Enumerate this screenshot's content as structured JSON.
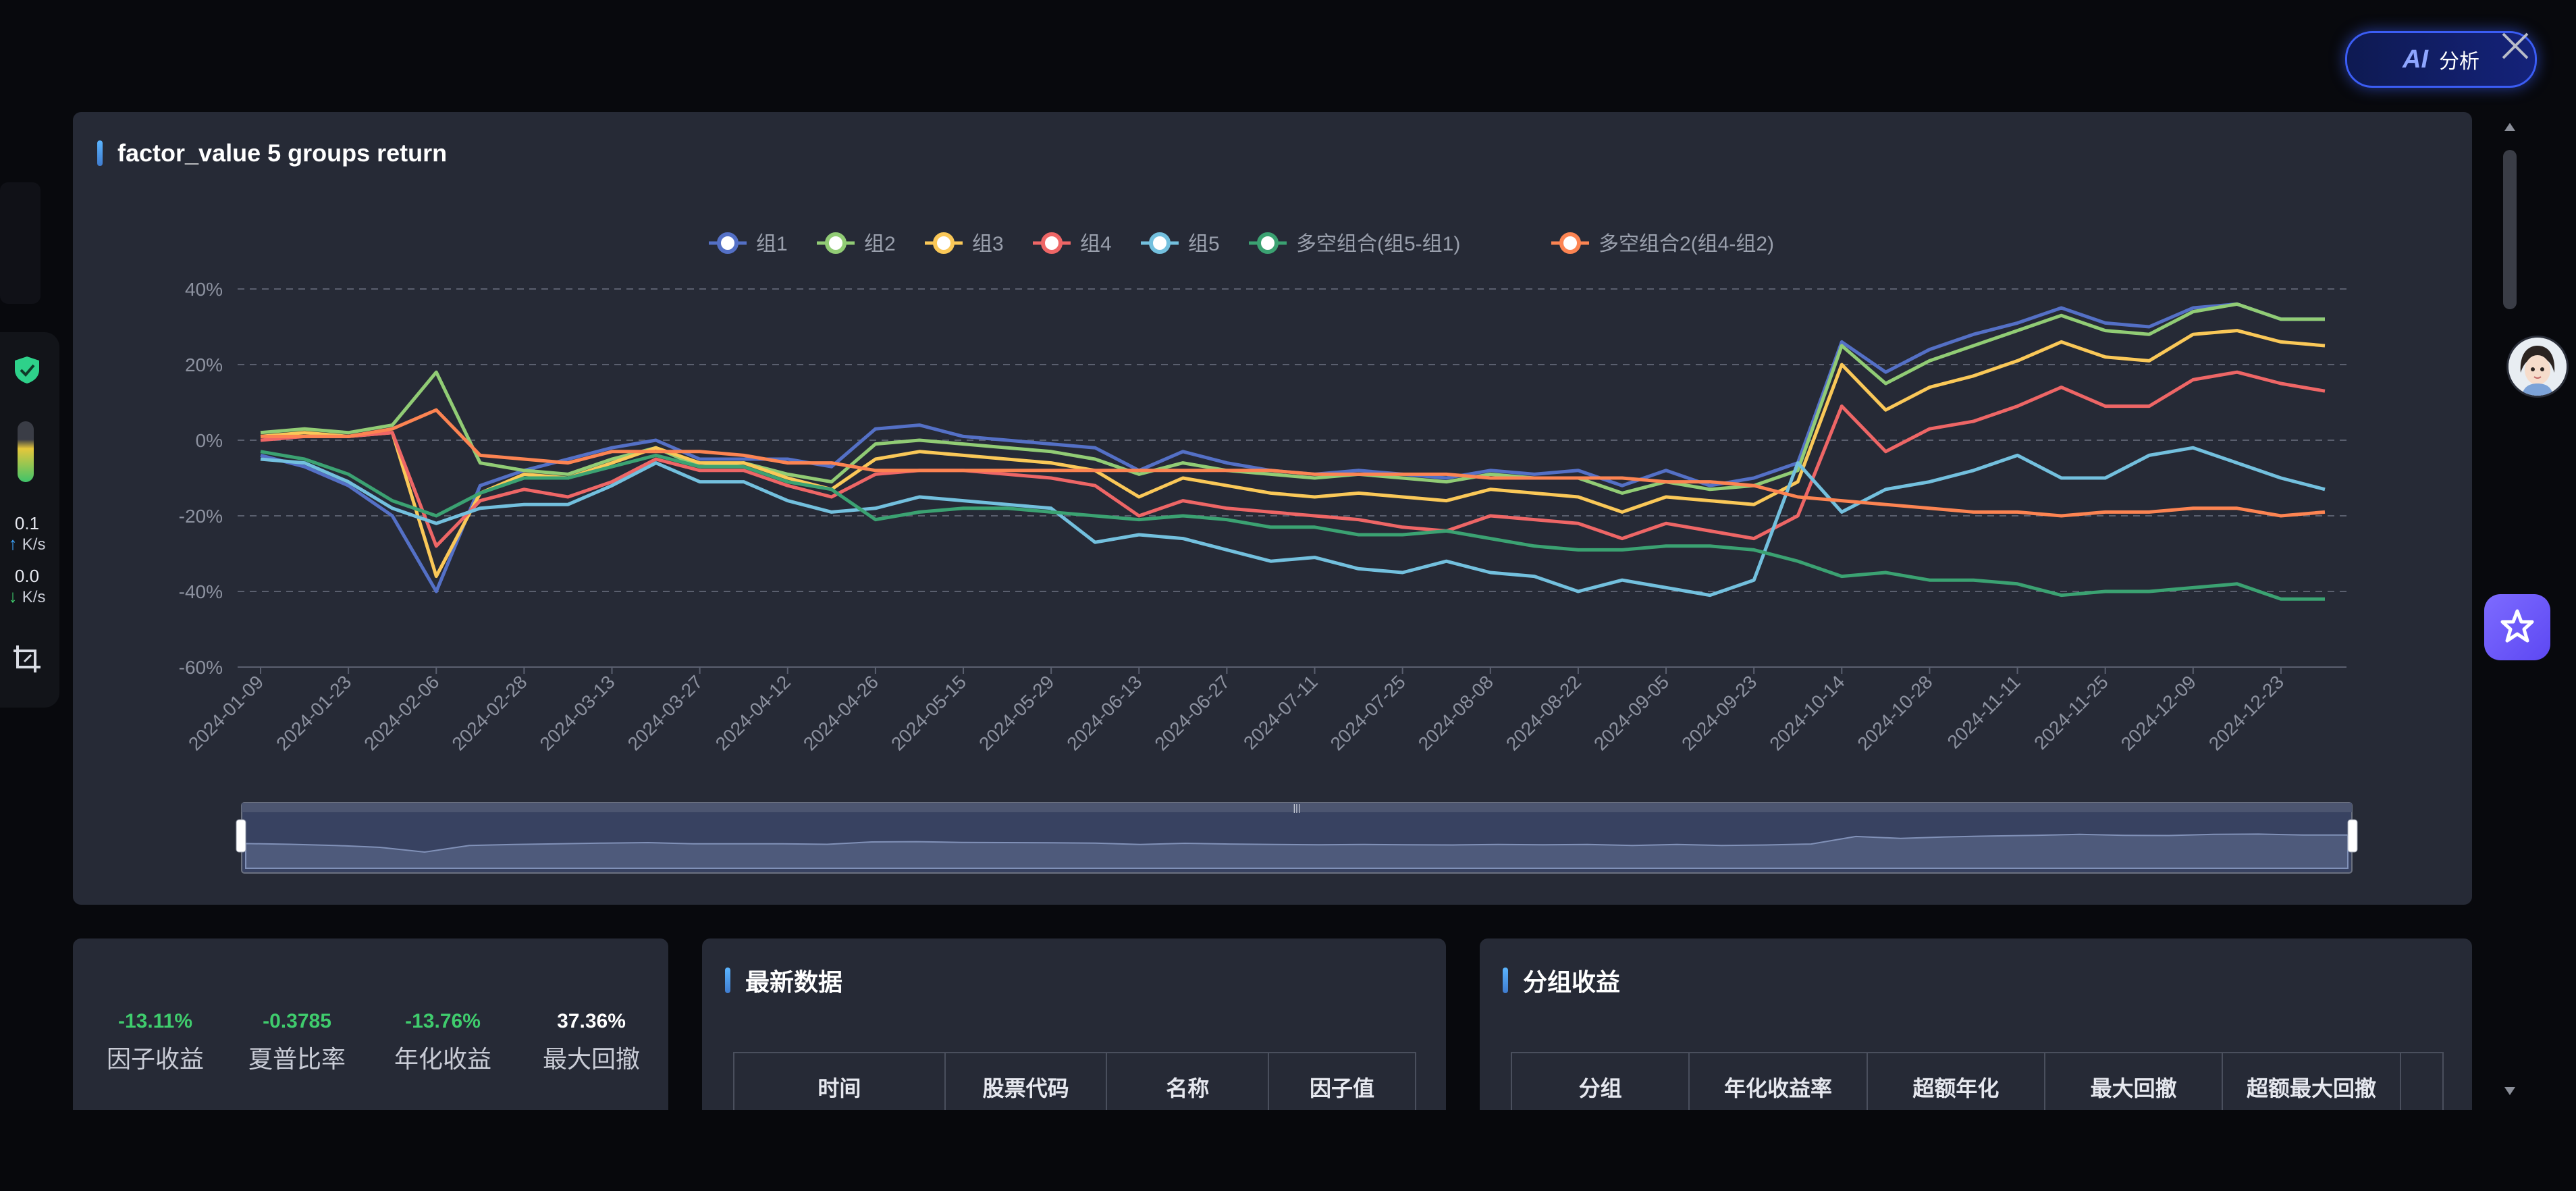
{
  "ai_button": {
    "glyph": "AI",
    "label": "分析"
  },
  "toolbar": {
    "upload_value": "0.1",
    "upload_unit": "K/s",
    "download_value": "0.0",
    "download_unit": "K/s"
  },
  "chart_panel": {
    "title": "factor_value 5 groups return"
  },
  "chart_data": {
    "type": "line",
    "title": "factor_value 5 groups return",
    "ylim": [
      -60,
      40
    ],
    "y_ticks": [
      "40%",
      "20%",
      "0%",
      "-20%",
      "-40%",
      "-60%"
    ],
    "x_tick_labels": [
      "2024-01-09",
      "2024-01-23",
      "2024-02-06",
      "2024-02-28",
      "2024-03-13",
      "2024-03-27",
      "2024-04-12",
      "2024-04-26",
      "2024-05-15",
      "2024-05-29",
      "2024-06-13",
      "2024-06-27",
      "2024-07-11",
      "2024-07-25",
      "2024-08-08",
      "2024-08-22",
      "2024-09-05",
      "2024-09-23",
      "2024-10-14",
      "2024-10-28",
      "2024-11-11",
      "2024-11-25",
      "2024-12-09",
      "2024-12-23"
    ],
    "x_count": 48,
    "grid": true,
    "legend_position": "top-center",
    "series": [
      {
        "name": "组1",
        "color": "#5470c6",
        "values": [
          -4,
          -7,
          -12,
          -20,
          -40,
          -12,
          -8,
          -5,
          -2,
          0,
          -5,
          -5,
          -5,
          -7,
          3,
          4,
          1,
          0,
          -1,
          -2,
          -8,
          -3,
          -6,
          -8,
          -9,
          -8,
          -9,
          -10,
          -8,
          -9,
          -8,
          -12,
          -8,
          -12,
          -10,
          -6,
          26,
          18,
          24,
          28,
          31,
          35,
          31,
          30,
          35,
          36,
          32,
          32
        ]
      },
      {
        "name": "组2",
        "color": "#91cc75",
        "values": [
          2,
          3,
          2,
          4,
          18,
          -6,
          -8,
          -9,
          -5,
          -2,
          -7,
          -6,
          -9,
          -11,
          -1,
          0,
          -1,
          -2,
          -3,
          -5,
          -9,
          -6,
          -8,
          -9,
          -10,
          -9,
          -10,
          -11,
          -9,
          -10,
          -10,
          -14,
          -11,
          -13,
          -12,
          -8,
          25,
          15,
          21,
          25,
          29,
          33,
          29,
          28,
          34,
          36,
          32,
          32
        ]
      },
      {
        "name": "组3",
        "color": "#fac858",
        "values": [
          1,
          2,
          1,
          2,
          -36,
          -14,
          -9,
          -10,
          -6,
          -2,
          -6,
          -6,
          -10,
          -13,
          -5,
          -3,
          -4,
          -5,
          -6,
          -8,
          -15,
          -10,
          -12,
          -14,
          -15,
          -14,
          -15,
          -16,
          -13,
          -14,
          -15,
          -19,
          -15,
          -16,
          -17,
          -11,
          20,
          8,
          14,
          17,
          21,
          26,
          22,
          21,
          28,
          29,
          26,
          25
        ]
      },
      {
        "name": "组4",
        "color": "#ee6666",
        "values": [
          0,
          1,
          1,
          2,
          -28,
          -16,
          -13,
          -15,
          -11,
          -5,
          -8,
          -8,
          -12,
          -15,
          -9,
          -8,
          -8,
          -9,
          -10,
          -12,
          -20,
          -16,
          -18,
          -19,
          -20,
          -21,
          -23,
          -24,
          -20,
          -21,
          -22,
          -26,
          -22,
          -24,
          -26,
          -20,
          9,
          -3,
          3,
          5,
          9,
          14,
          9,
          9,
          16,
          18,
          15,
          13
        ]
      },
      {
        "name": "组5",
        "color": "#73c0de",
        "values": [
          -5,
          -6,
          -11,
          -18,
          -22,
          -18,
          -17,
          -17,
          -12,
          -6,
          -11,
          -11,
          -16,
          -19,
          -18,
          -15,
          -16,
          -17,
          -18,
          -27,
          -25,
          -26,
          -29,
          -32,
          -31,
          -34,
          -35,
          -32,
          -35,
          -36,
          -40,
          -37,
          -39,
          -41,
          -37,
          -6,
          -19,
          -13,
          -11,
          -8,
          -4,
          -10,
          -10,
          -4,
          -2,
          -6,
          -10,
          -13
        ]
      },
      {
        "name": "多空组合(组5-组1)",
        "color": "#3ba272",
        "values": [
          -3,
          -5,
          -9,
          -16,
          -20,
          -14,
          -10,
          -10,
          -7,
          -4,
          -7,
          -7,
          -11,
          -13,
          -21,
          -19,
          -18,
          -18,
          -19,
          -20,
          -21,
          -20,
          -21,
          -23,
          -23,
          -25,
          -25,
          -24,
          -26,
          -28,
          -29,
          -29,
          -28,
          -28,
          -29,
          -32,
          -36,
          -35,
          -37,
          -37,
          -38,
          -41,
          -40,
          -40,
          -39,
          -38,
          -42,
          -42
        ]
      },
      {
        "name": "多空组合2(组4-组2)",
        "color": "#fc8452",
        "values": [
          1,
          1,
          1,
          3,
          8,
          -4,
          -5,
          -6,
          -3,
          -3,
          -3,
          -4,
          -6,
          -6,
          -8,
          -8,
          -8,
          -8,
          -8,
          -8,
          -8,
          -8,
          -8,
          -8,
          -9,
          -9,
          -9,
          -9,
          -10,
          -10,
          -10,
          -10,
          -11,
          -11,
          -12,
          -15,
          -16,
          -17,
          -18,
          -19,
          -19,
          -20,
          -19,
          -19,
          -18,
          -18,
          -20,
          -19
        ]
      }
    ]
  },
  "stats": [
    {
      "value": "-13.11%",
      "label": "因子收益"
    },
    {
      "value": "-0.3785",
      "label": "夏普比率"
    },
    {
      "value": "-13.76%",
      "label": "年化收益"
    },
    {
      "value": "37.36%",
      "label": "最大回撤"
    }
  ],
  "latest_panel": {
    "title": "最新数据",
    "columns": [
      "时间",
      "股票代码",
      "名称",
      "因子值"
    ]
  },
  "group_panel": {
    "title": "分组收益",
    "columns": [
      "分组",
      "年化收益率",
      "超额年化",
      "最大回撤",
      "超额最大回撤"
    ]
  }
}
